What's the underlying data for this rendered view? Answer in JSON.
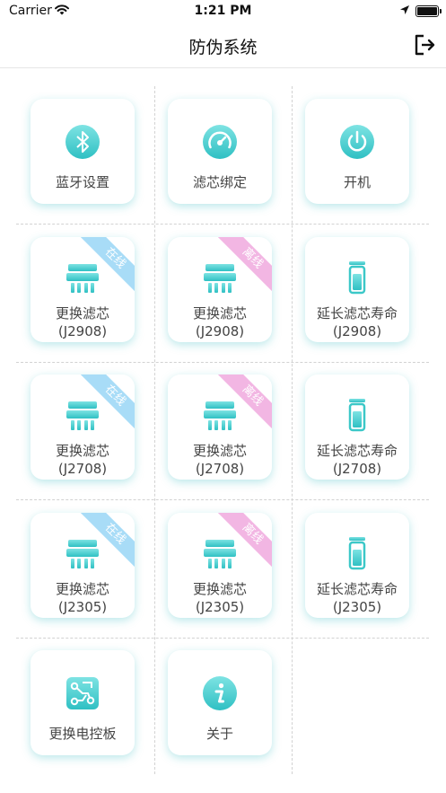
{
  "status": {
    "carrier": "Carrier",
    "time": "1:21 PM"
  },
  "nav": {
    "title": "防伪系统"
  },
  "tiles": {
    "bluetooth": {
      "label": "蓝牙设置"
    },
    "filter_bind": {
      "label": "滤芯绑定"
    },
    "power": {
      "label": "开机"
    },
    "r1c1": {
      "label": "更换滤芯",
      "model": "(J2908)",
      "badge": "在线"
    },
    "r1c2": {
      "label": "更换滤芯",
      "model": "(J2908)",
      "badge": "离线"
    },
    "r1c3": {
      "label": "延长滤芯寿命",
      "model": "(J2908)"
    },
    "r2c1": {
      "label": "更换滤芯",
      "model": "(J2708)",
      "badge": "在线"
    },
    "r2c2": {
      "label": "更换滤芯",
      "model": "(J2708)",
      "badge": "离线"
    },
    "r2c3": {
      "label": "延长滤芯寿命",
      "model": "(J2708)"
    },
    "r3c1": {
      "label": "更换滤芯",
      "model": "(J2305)",
      "badge": "在线"
    },
    "r3c2": {
      "label": "更换滤芯",
      "model": "(J2305)",
      "badge": "离线"
    },
    "r3c3": {
      "label": "延长滤芯寿命",
      "model": "(J2305)"
    },
    "board": {
      "label": "更换电控板"
    },
    "about": {
      "label": "关于"
    }
  },
  "icons": {
    "bluetooth": "bluetooth-icon",
    "gauge": "gauge-icon",
    "power": "power-icon",
    "filter": "filter-icon",
    "cartridge": "cartridge-icon",
    "circuit": "circuit-board-icon",
    "info": "info-icon",
    "logout": "logout-icon"
  },
  "colors": {
    "accent": "#3cc8c8",
    "online": "#a8dcf7",
    "offline": "#f2b6e3"
  }
}
